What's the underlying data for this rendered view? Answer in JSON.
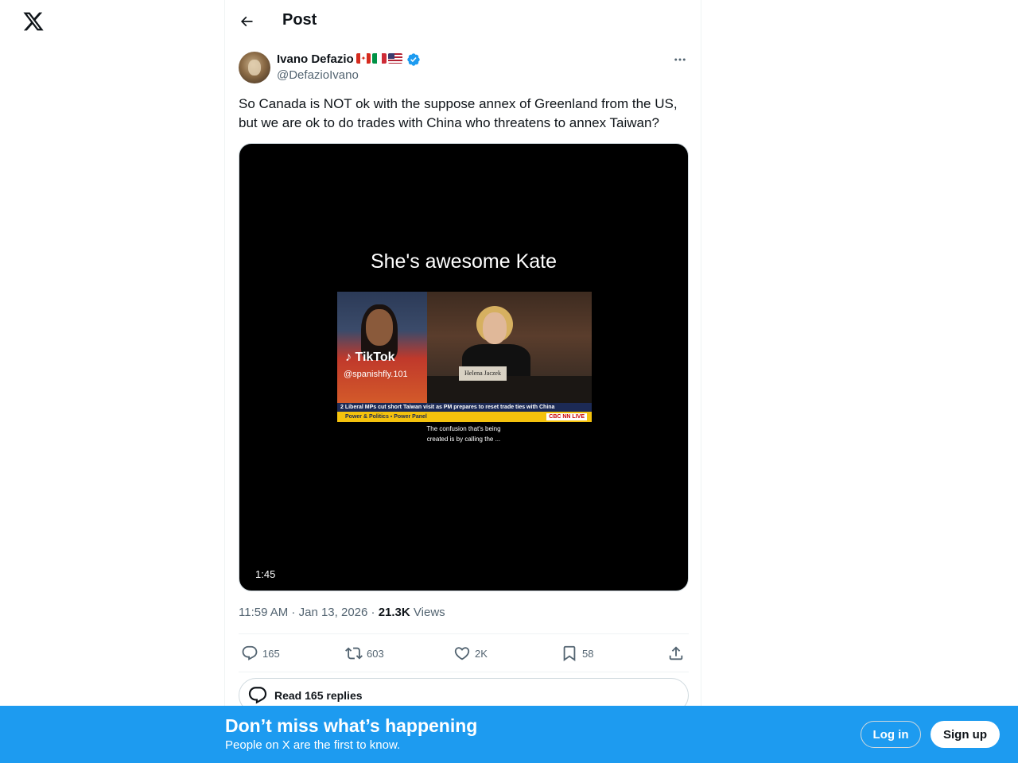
{
  "header": {
    "title": "Post"
  },
  "author": {
    "name": "Ivano Defazio",
    "handle": "@DefazioIvano",
    "flags": [
      "canada-flag",
      "italy-flag",
      "usa-flag"
    ]
  },
  "tweet": {
    "text_line1": "So Canada is NOT ok with the suppose annex of Greenland from the US,",
    "text_line2": "but we are ok to do trades with China who threatens to annex Taiwan?"
  },
  "media": {
    "overlay_title": "She's awesome Kate",
    "watermark": "TikTok",
    "watermark_handle": "@spanishfly.101",
    "nameplate": "Helena Jaczek",
    "ticker": "2 Liberal MPs cut short Taiwan visit as PM prepares to reset trade ties with China",
    "ticker_show": "Power & Politics  ▪  Power Panel",
    "network_tag": "CBC NN LIVE",
    "caption_line1": "The confusion that's being",
    "caption_line2": "created is by calling the ...",
    "duration": "1:45"
  },
  "meta": {
    "time": "11:59 AM",
    "date": "Jan 13, 2026",
    "views_count": "21.3K",
    "views_label": "Views"
  },
  "actions": {
    "replies": "165",
    "reposts": "603",
    "likes": "2K",
    "bookmarks": "58"
  },
  "read_replies": {
    "label": "Read 165 replies"
  },
  "banner": {
    "title": "Don’t miss what’s happening",
    "subtitle": "People on X are the first to know.",
    "login_label": "Log in",
    "signup_label": "Sign up"
  },
  "colors": {
    "accent": "#1d9bf0",
    "text_primary": "#0f1419",
    "text_secondary": "#536471",
    "border": "#cfd9de"
  }
}
